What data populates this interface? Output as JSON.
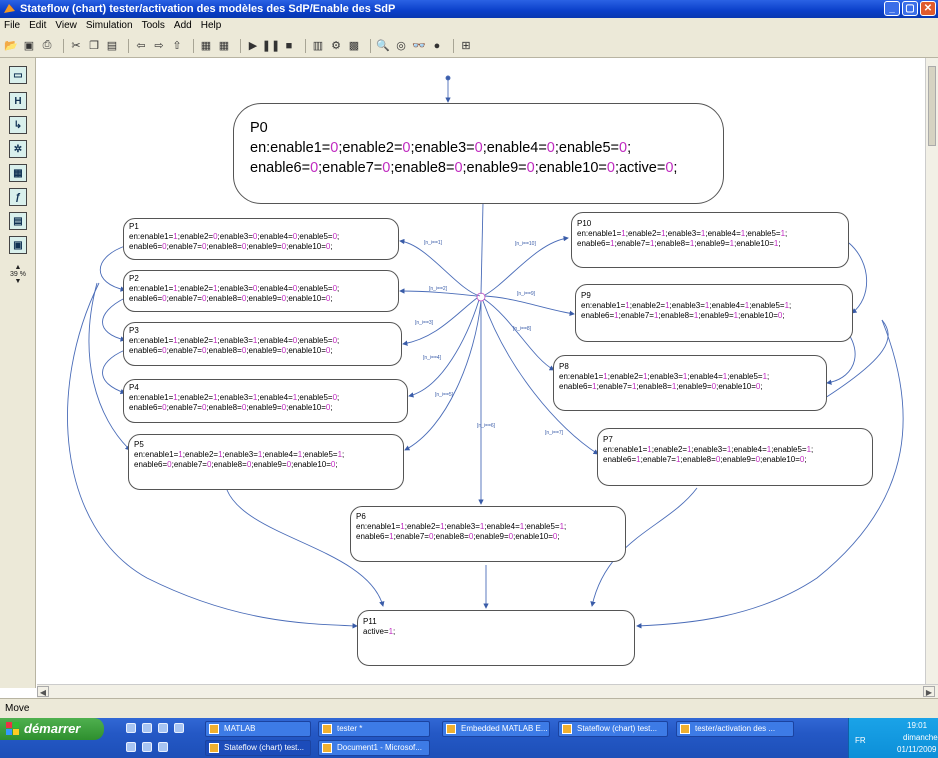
{
  "window": {
    "title": "Stateflow (chart) tester/activation des modèles des SdP/Enable des SdP",
    "buttons": [
      "_",
      "▢",
      "✕"
    ]
  },
  "menu": [
    "File",
    "Edit",
    "View",
    "Simulation",
    "Tools",
    "Add",
    "Help"
  ],
  "zoom": "39 %",
  "status": "Move",
  "states": {
    "P0": {
      "name": "P0",
      "line1": [
        "en:enable1=",
        "0",
        ";enable2=",
        "0",
        ";enable3=",
        "0",
        ";enable4=",
        "0",
        ";enable5=",
        "0",
        ";"
      ],
      "line2": [
        "enable6=",
        "0",
        ";enable7=",
        "0",
        ";enable8=",
        "0",
        ";enable9=",
        "0",
        ";enable10=",
        "0",
        ";active=",
        "0",
        ";"
      ]
    },
    "P1": {
      "name": "P1",
      "line1": [
        "en:enable1=",
        "1",
        ";enable2=",
        "0",
        ";enable3=",
        "0",
        ";enable4=",
        "0",
        ";enable5=",
        "0",
        ";"
      ],
      "line2": [
        "enable6=",
        "0",
        ";enable7=",
        "0",
        ";enable8=",
        "0",
        ";enable9=",
        "0",
        ";enable10=",
        "0",
        ";"
      ]
    },
    "P2": {
      "name": "P2",
      "line1": [
        "en:enable1=",
        "1",
        ";enable2=",
        "1",
        ";enable3=",
        "0",
        ";enable4=",
        "0",
        ";enable5=",
        "0",
        ";"
      ],
      "line2": [
        "enable6=",
        "0",
        ";enable7=",
        "0",
        ";enable8=",
        "0",
        ";enable9=",
        "0",
        ";enable10=",
        "0",
        ";"
      ]
    },
    "P3": {
      "name": "P3",
      "line1": [
        "en:enable1=",
        "1",
        ";enable2=",
        "1",
        ";enable3=",
        "1",
        ";enable4=",
        "0",
        ";enable5=",
        "0",
        ";"
      ],
      "line2": [
        "enable6=",
        "0",
        ";enable7=",
        "0",
        ";enable8=",
        "0",
        ";enable9=",
        "0",
        ";enable10=",
        "0",
        ";"
      ]
    },
    "P4": {
      "name": "P4",
      "line1": [
        "en:enable1=",
        "1",
        ";enable2=",
        "1",
        ";enable3=",
        "1",
        ";enable4=",
        "1",
        ";enable5=",
        "0",
        ";"
      ],
      "line2": [
        "enable6=",
        "0",
        ";enable7=",
        "0",
        ";enable8=",
        "0",
        ";enable9=",
        "0",
        ";enable10=",
        "0",
        ";"
      ]
    },
    "P5": {
      "name": "P5",
      "line1": [
        "en:enable1=",
        "1",
        ";enable2=",
        "1",
        ";enable3=",
        "1",
        ";enable4=",
        "1",
        ";enable5=",
        "1",
        ";"
      ],
      "line2": [
        "enable6=",
        "0",
        ";enable7=",
        "0",
        ";enable8=",
        "0",
        ";enable9=",
        "0",
        ";enable10=",
        "0",
        ";"
      ]
    },
    "P6": {
      "name": "P6",
      "line1": [
        "en:enable1=",
        "1",
        ";enable2=",
        "1",
        ";enable3=",
        "1",
        ";enable4=",
        "1",
        ";enable5=",
        "1",
        ";"
      ],
      "line2": [
        "enable6=",
        "1",
        ";enable7=",
        "0",
        ";enable8=",
        "0",
        ";enable9=",
        "0",
        ";enable10=",
        "0",
        ";"
      ]
    },
    "P7": {
      "name": "P7",
      "line1": [
        "en:enable1=",
        "1",
        ";enable2=",
        "1",
        ";enable3=",
        "1",
        ";enable4=",
        "1",
        ";enable5=",
        "1",
        ";"
      ],
      "line2": [
        "enable6=",
        "1",
        ";enable7=",
        "1",
        ";enable8=",
        "0",
        ";enable9=",
        "0",
        ";enable10=",
        "0",
        ";"
      ]
    },
    "P8": {
      "name": "P8",
      "line1": [
        "en:enable1=",
        "1",
        ";enable2=",
        "1",
        ";enable3=",
        "1",
        ";enable4=",
        "1",
        ";enable5=",
        "1",
        ";"
      ],
      "line2": [
        "enable6=",
        "1",
        ";enable7=",
        "1",
        ";enable8=",
        "1",
        ";enable9=",
        "0",
        ";enable10=",
        "0",
        ";"
      ]
    },
    "P9": {
      "name": "P9",
      "line1": [
        "en:enable1=",
        "1",
        ";enable2=",
        "1",
        ";enable3=",
        "1",
        ";enable4=",
        "1",
        ";enable5=",
        "1",
        ";"
      ],
      "line2": [
        "enable6=",
        "1",
        ";enable7=",
        "1",
        ";enable8=",
        "1",
        ";enable9=",
        "1",
        ";enable10=",
        "0",
        ";"
      ]
    },
    "P10": {
      "name": "P10",
      "line1": [
        "en:enable1=",
        "1",
        ";enable2=",
        "1",
        ";enable3=",
        "1",
        ";enable4=",
        "1",
        ";enable5=",
        "1",
        ";"
      ],
      "line2": [
        "enable6=",
        "1",
        ";enable7=",
        "1",
        ";enable8=",
        "1",
        ";enable9=",
        "1",
        ";enable10=",
        "1",
        ";"
      ]
    },
    "P11": {
      "name": "P11",
      "line1": [
        "active=",
        "1",
        ";"
      ],
      "line2": []
    }
  },
  "taskbar": {
    "start": "démarrer",
    "tasks_top": [
      "MATLAB",
      "tester *",
      "Embedded MATLAB E...",
      "Stateflow (chart) test...",
      "tester/activation des ..."
    ],
    "tasks_bottom": [
      "Stateflow (chart) test...",
      "Document1 - Microsof..."
    ],
    "lang": "FR",
    "time": "19:01",
    "day": "dimanche",
    "date": "01/11/2009"
  }
}
